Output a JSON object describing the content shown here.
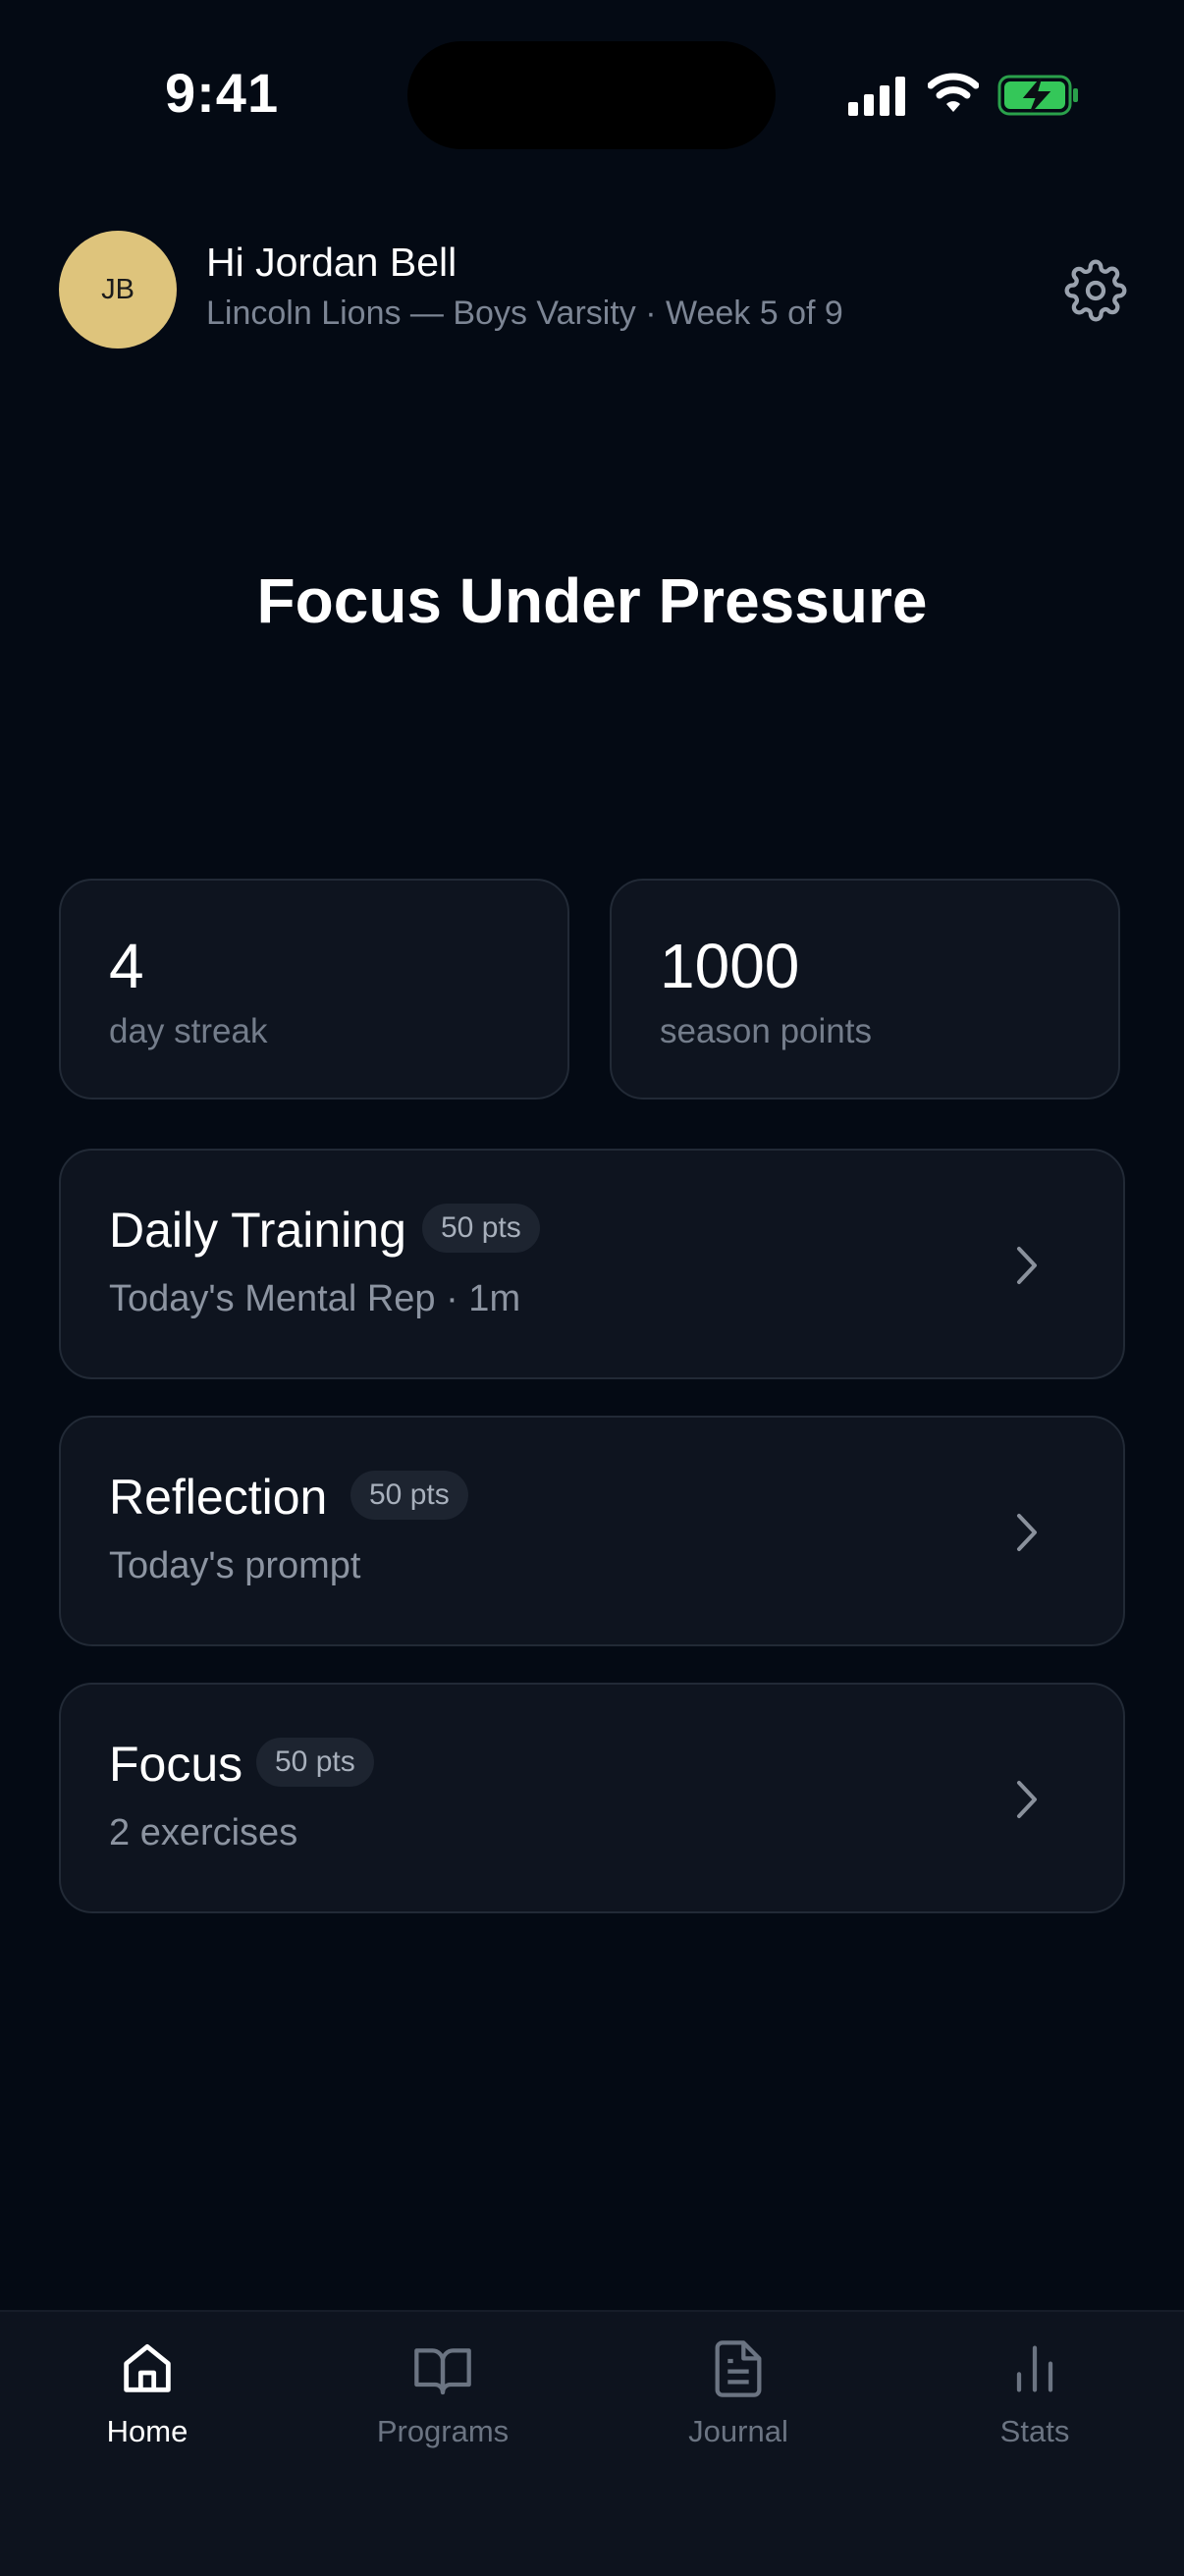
{
  "status_bar": {
    "time": "9:41"
  },
  "header": {
    "avatar_initials": "JB",
    "greeting": "Hi Jordan Bell",
    "subtitle": "Lincoln Lions — Boys Varsity · Week 5 of 9"
  },
  "focus_title": "Focus Under Pressure",
  "stats": [
    {
      "value": "4",
      "label": "day streak"
    },
    {
      "value": "1000",
      "label": "season points"
    }
  ],
  "tasks": [
    {
      "title": "Daily Training",
      "points": "50 pts",
      "subtitle": "Today's Mental Rep · 1m"
    },
    {
      "title": "Reflection",
      "points": "50 pts",
      "subtitle": "Today's prompt"
    },
    {
      "title": "Focus",
      "points": "50 pts",
      "subtitle": "2 exercises"
    }
  ],
  "tabs": [
    {
      "label": "Home",
      "icon": "home-icon",
      "active": true
    },
    {
      "label": "Programs",
      "icon": "book-icon",
      "active": false
    },
    {
      "label": "Journal",
      "icon": "document-icon",
      "active": false
    },
    {
      "label": "Stats",
      "icon": "bar-chart-icon",
      "active": false
    }
  ],
  "colors": {
    "background": "#040a14",
    "card": "#0e141f",
    "avatar": "#dec47c",
    "battery": "#34c759"
  }
}
